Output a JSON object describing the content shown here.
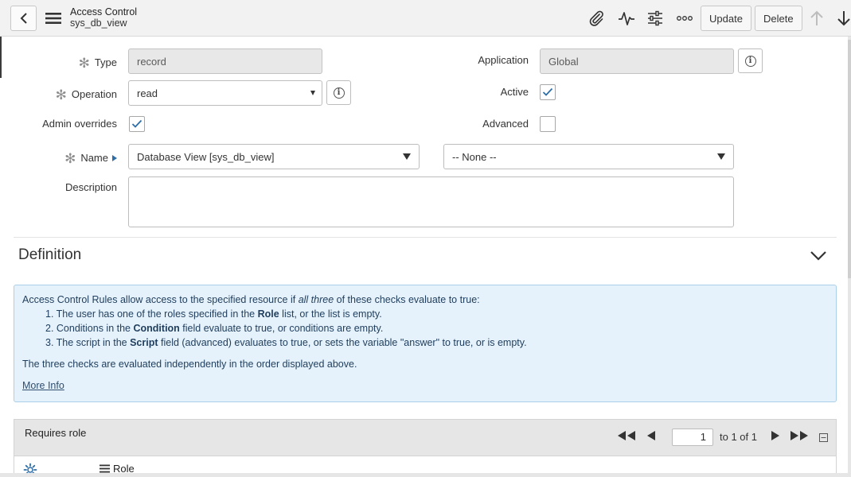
{
  "header": {
    "title": "Access Control",
    "subtitle": "sys_db_view",
    "update_label": "Update",
    "delete_label": "Delete",
    "icons": [
      "back-icon",
      "hamburger-menu-icon",
      "paperclip-icon",
      "activity-icon",
      "settings-sliders-icon",
      "more-options-icon",
      "arrow-up-icon",
      "arrow-down-icon"
    ]
  },
  "form": {
    "type_label": "Type",
    "type_value": "record",
    "operation_label": "Operation",
    "operation_value": "read",
    "admin_overrides_label": "Admin overrides",
    "admin_overrides_checked": true,
    "name_label": "Name",
    "name_table_value": "Database View [sys_db_view]",
    "name_field_value": "-- None --",
    "description_label": "Description",
    "description_value": "",
    "application_label": "Application",
    "application_value": "Global",
    "active_label": "Active",
    "active_checked": true,
    "advanced_label": "Advanced",
    "advanced_checked": false
  },
  "definition": {
    "title": "Definition",
    "intro_pre": "Access Control Rules allow access to the specified resource if ",
    "intro_em": "all three",
    "intro_post": " of these checks evaluate to true:",
    "item1_pre": "1. The user has one of the roles specified in the ",
    "item1_bold": "Role",
    "item1_post": " list, or the list is empty.",
    "item2_pre": "2. Conditions in the ",
    "item2_bold": "Condition",
    "item2_post": " field evaluate to true, or conditions are empty.",
    "item3_pre": "3. The script in the ",
    "item3_bold": "Script",
    "item3_post": " field (advanced) evaluates to true, or sets the variable \"answer\" to true, or is empty.",
    "summary": "The three checks are evaluated independently in the order displayed above.",
    "more_info": "More Info"
  },
  "related_list": {
    "title": "Requires role",
    "page_value": "1",
    "page_of": "to 1 of 1",
    "column_role": "Role"
  },
  "colors": {
    "header_bg": "#f2f2f2",
    "info_bg": "#e5f2fb",
    "info_border": "#a9cfe9",
    "check_blue": "#2e6ea8",
    "link_blue": "#2f4e6e"
  }
}
